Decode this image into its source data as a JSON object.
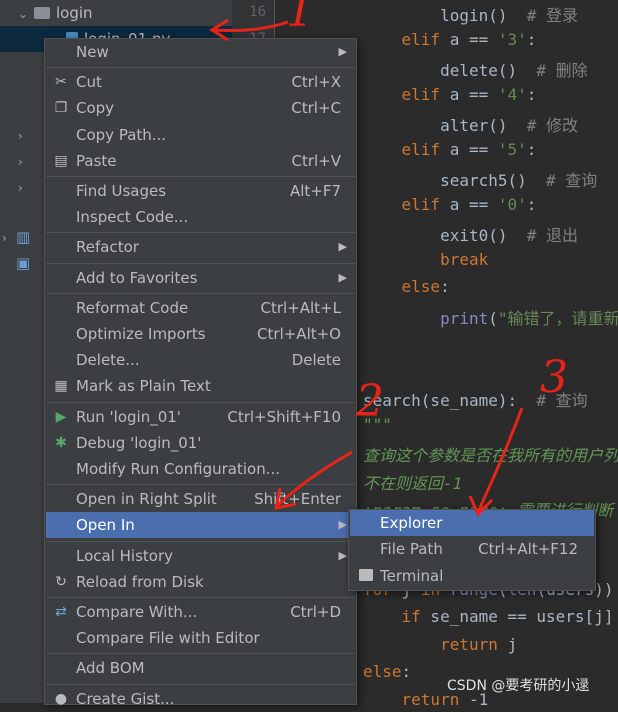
{
  "tree": {
    "folder": "login",
    "file": "login_01.py"
  },
  "gutter": {
    "lines": [
      "16",
      "17"
    ]
  },
  "editor": {
    "lines": [
      {
        "parts": [
          {
            "t": "        login()  ",
            "c": ""
          },
          {
            "t": "# 登录",
            "c": "cmt"
          }
        ]
      },
      {
        "parts": [
          {
            "t": "    ",
            "c": ""
          },
          {
            "t": "elif",
            "c": "kw"
          },
          {
            "t": " a == ",
            "c": ""
          },
          {
            "t": "'3'",
            "c": "str"
          },
          {
            "t": ":",
            "c": ""
          }
        ]
      },
      {
        "parts": [
          {
            "t": "        delete()  ",
            "c": ""
          },
          {
            "t": "# 删除",
            "c": "cmt"
          }
        ]
      },
      {
        "parts": [
          {
            "t": "    ",
            "c": ""
          },
          {
            "t": "elif",
            "c": "kw"
          },
          {
            "t": " a == ",
            "c": ""
          },
          {
            "t": "'4'",
            "c": "str"
          },
          {
            "t": ":",
            "c": ""
          }
        ]
      },
      {
        "parts": [
          {
            "t": "        alter()  ",
            "c": ""
          },
          {
            "t": "# 修改",
            "c": "cmt"
          }
        ]
      },
      {
        "parts": [
          {
            "t": "    ",
            "c": ""
          },
          {
            "t": "elif",
            "c": "kw"
          },
          {
            "t": " a == ",
            "c": ""
          },
          {
            "t": "'5'",
            "c": "str"
          },
          {
            "t": ":",
            "c": ""
          }
        ]
      },
      {
        "parts": [
          {
            "t": "        search5()  ",
            "c": ""
          },
          {
            "t": "# 查询",
            "c": "cmt"
          }
        ]
      },
      {
        "parts": [
          {
            "t": "    ",
            "c": ""
          },
          {
            "t": "elif",
            "c": "kw"
          },
          {
            "t": " a == ",
            "c": ""
          },
          {
            "t": "'0'",
            "c": "str"
          },
          {
            "t": ":",
            "c": ""
          }
        ]
      },
      {
        "parts": [
          {
            "t": "        exit0()  ",
            "c": ""
          },
          {
            "t": "# 退出",
            "c": "cmt"
          }
        ]
      },
      {
        "parts": [
          {
            "t": "        ",
            "c": ""
          },
          {
            "t": "break",
            "c": "kw"
          }
        ]
      },
      {
        "parts": [
          {
            "t": "    ",
            "c": ""
          },
          {
            "t": "else",
            "c": "kw"
          },
          {
            "t": ":",
            "c": ""
          }
        ]
      },
      {
        "parts": [
          {
            "t": "        ",
            "c": ""
          },
          {
            "t": "print",
            "c": "builtin"
          },
          {
            "t": "(",
            "c": ""
          },
          {
            "t": "\"输错了，请重新",
            "c": "str"
          }
        ]
      },
      {
        "parts": []
      },
      {
        "parts": []
      },
      {
        "parts": [
          {
            "t": "search(se_name):  ",
            "c": ""
          },
          {
            "t": "# 查询",
            "c": "cmt"
          }
        ]
      },
      {
        "parts": [
          {
            "t": "\"\"\"",
            "c": "doc"
          }
        ]
      },
      {
        "parts": [
          {
            "t": "查询这个参数是否在我所有的用户列",
            "c": "doc"
          }
        ]
      },
      {
        "parts": [
          {
            "t": "不在则返回-1",
            "c": "doc"
          }
        ]
      },
      {
        "parts": [
          {
            "t": ":param se_name: 需要进行判断",
            "c": "doc"
          }
        ]
      },
      {
        "parts": []
      },
      {
        "parts": []
      },
      {
        "parts": [
          {
            "t": "for",
            "c": "kw"
          },
          {
            "t": " j ",
            "c": ""
          },
          {
            "t": "in",
            "c": "kw"
          },
          {
            "t": " ",
            "c": ""
          },
          {
            "t": "range",
            "c": "builtin"
          },
          {
            "t": "(",
            "c": ""
          },
          {
            "t": "len",
            "c": "builtin"
          },
          {
            "t": "(users))",
            "c": ""
          }
        ]
      },
      {
        "parts": [
          {
            "t": "    ",
            "c": ""
          },
          {
            "t": "if",
            "c": "kw"
          },
          {
            "t": " se_name == users[j]",
            "c": ""
          }
        ]
      },
      {
        "parts": [
          {
            "t": "        ",
            "c": ""
          },
          {
            "t": "return",
            "c": "kw"
          },
          {
            "t": " j",
            "c": ""
          }
        ]
      },
      {
        "parts": [
          {
            "t": "else",
            "c": "kw"
          },
          {
            "t": ":",
            "c": ""
          }
        ]
      },
      {
        "parts": [
          {
            "t": "    ",
            "c": ""
          },
          {
            "t": "return",
            "c": "kw"
          },
          {
            "t": " -1",
            "c": ""
          }
        ]
      }
    ]
  },
  "menu": {
    "items": [
      {
        "label": "New",
        "sc": "",
        "sub": true,
        "icon": ""
      },
      {
        "sep": true
      },
      {
        "label": "Cut",
        "sc": "Ctrl+X",
        "icon": "scissors-icon"
      },
      {
        "label": "Copy",
        "sc": "Ctrl+C",
        "icon": "copy-icon"
      },
      {
        "label": "Copy Path...",
        "sc": "",
        "icon": ""
      },
      {
        "label": "Paste",
        "sc": "Ctrl+V",
        "icon": "clipboard-icon"
      },
      {
        "sep": true
      },
      {
        "label": "Find Usages",
        "sc": "Alt+F7",
        "icon": ""
      },
      {
        "label": "Inspect Code...",
        "sc": "",
        "icon": ""
      },
      {
        "sep": true
      },
      {
        "label": "Refactor",
        "sc": "",
        "sub": true,
        "icon": ""
      },
      {
        "sep": true
      },
      {
        "label": "Add to Favorites",
        "sc": "",
        "sub": true,
        "icon": ""
      },
      {
        "sep": true
      },
      {
        "label": "Reformat Code",
        "sc": "Ctrl+Alt+L",
        "icon": ""
      },
      {
        "label": "Optimize Imports",
        "sc": "Ctrl+Alt+O",
        "icon": ""
      },
      {
        "label": "Delete...",
        "sc": "Delete",
        "icon": ""
      },
      {
        "label": "Mark as Plain Text",
        "sc": "",
        "icon": "plain-text-icon"
      },
      {
        "sep": true
      },
      {
        "label": "Run 'login_01'",
        "sc": "Ctrl+Shift+F10",
        "icon": "run-icon"
      },
      {
        "label": "Debug 'login_01'",
        "sc": "",
        "icon": "debug-icon"
      },
      {
        "label": "Modify Run Configuration...",
        "sc": "",
        "icon": ""
      },
      {
        "sep": true
      },
      {
        "label": "Open in Right Split",
        "sc": "Shift+Enter",
        "icon": ""
      },
      {
        "label": "Open In",
        "sc": "",
        "sub": true,
        "icon": "",
        "hl": true
      },
      {
        "sep": true
      },
      {
        "label": "Local History",
        "sc": "",
        "sub": true,
        "icon": ""
      },
      {
        "label": "Reload from Disk",
        "sc": "",
        "icon": "reload-icon"
      },
      {
        "sep": true
      },
      {
        "label": "Compare With...",
        "sc": "Ctrl+D",
        "icon": "compare-icon"
      },
      {
        "label": "Compare File with Editor",
        "sc": "",
        "icon": ""
      },
      {
        "sep": true
      },
      {
        "label": "Add BOM",
        "sc": "",
        "icon": ""
      },
      {
        "sep": true
      },
      {
        "label": "Create Gist...",
        "sc": "",
        "icon": "github-icon"
      }
    ]
  },
  "submenu": {
    "items": [
      {
        "label": "Explorer",
        "sc": "",
        "hl": true,
        "icon": ""
      },
      {
        "label": "File Path",
        "sc": "Ctrl+Alt+F12",
        "icon": ""
      },
      {
        "label": "Terminal",
        "sc": "",
        "icon": "terminal-icon"
      }
    ]
  },
  "annotations": [
    "1",
    "2",
    "3"
  ],
  "watermark": "CSDN @要考研的小逯",
  "colors": {
    "highlight": "#4b6eaf",
    "annotation": "#e8231a"
  }
}
